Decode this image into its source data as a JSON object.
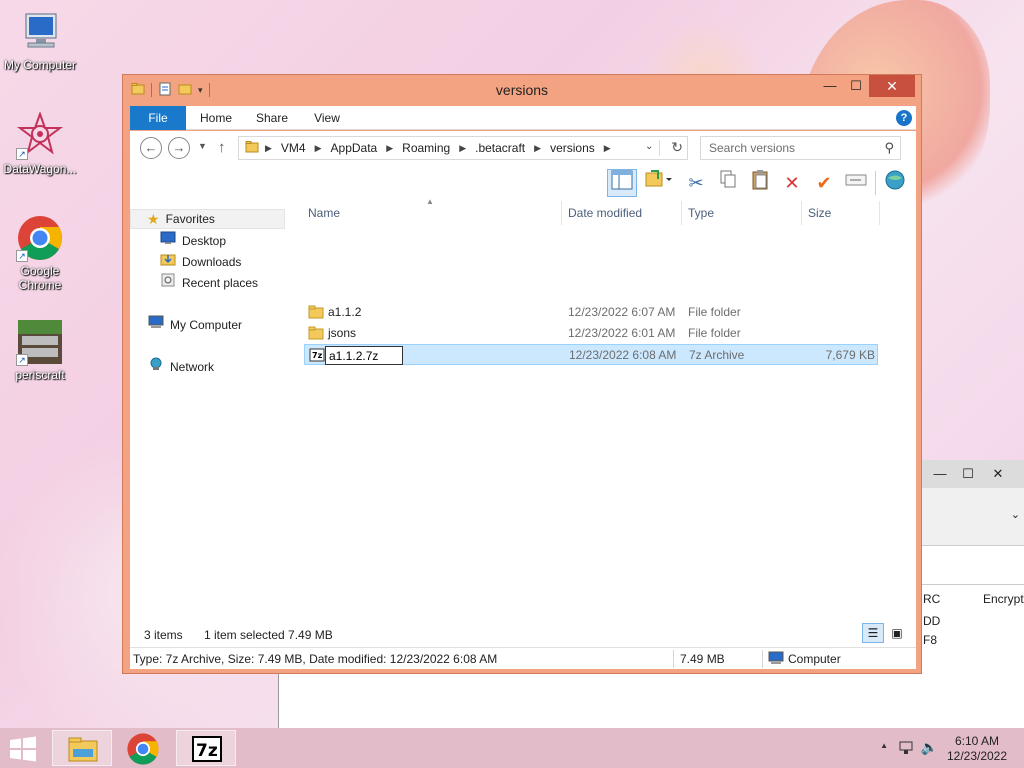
{
  "desktop": {
    "icons": [
      {
        "label": "My Computer"
      },
      {
        "label": "DataWagon..."
      },
      {
        "label": "Google Chrome"
      },
      {
        "label": "periscraft"
      }
    ]
  },
  "background_window": {
    "minimize": "—",
    "maximize": "☐",
    "close": "✕",
    "header_col1": "RC",
    "header_col2": "Encrypte",
    "line1": "DD",
    "line2": "F8"
  },
  "explorer": {
    "title": "versions",
    "controls": {
      "minimize": "—",
      "maximize": "☐",
      "close": "✕"
    },
    "tabs": {
      "file": "File",
      "home": "Home",
      "share": "Share",
      "view": "View"
    },
    "help": "?",
    "address": {
      "crumbs": [
        "VM4",
        "AppData",
        "Roaming",
        ".betacraft",
        "versions"
      ]
    },
    "search": {
      "placeholder": "Search versions"
    },
    "nav_pane": {
      "favorites": "Favorites",
      "desktop": "Desktop",
      "downloads": "Downloads",
      "recent": "Recent places",
      "computer": "My Computer",
      "network": "Network"
    },
    "columns": {
      "name": "Name",
      "date": "Date modified",
      "type": "Type",
      "size": "Size"
    },
    "files": [
      {
        "name": "a1.1.2",
        "date": "12/23/2022 6:07 AM",
        "type": "File folder",
        "size": ""
      },
      {
        "name": "jsons",
        "date": "12/23/2022 6:01 AM",
        "type": "File folder",
        "size": ""
      },
      {
        "name": "a1.1.2.7z",
        "date": "12/23/2022 6:08 AM",
        "type": "7z Archive",
        "size": "7,679 KB"
      }
    ],
    "rename_value": "a1.1.2.7z",
    "status": {
      "items": "3 items",
      "selected": "1 item selected  7.49 MB"
    },
    "details": {
      "info": "Type: 7z Archive, Size: 7.49 MB, Date modified: 12/23/2022 6:08 AM",
      "size": "7.49 MB",
      "location": "Computer"
    }
  },
  "taskbar": {
    "time": "6:10 AM",
    "date": "12/23/2022",
    "tray_up": "▲"
  }
}
